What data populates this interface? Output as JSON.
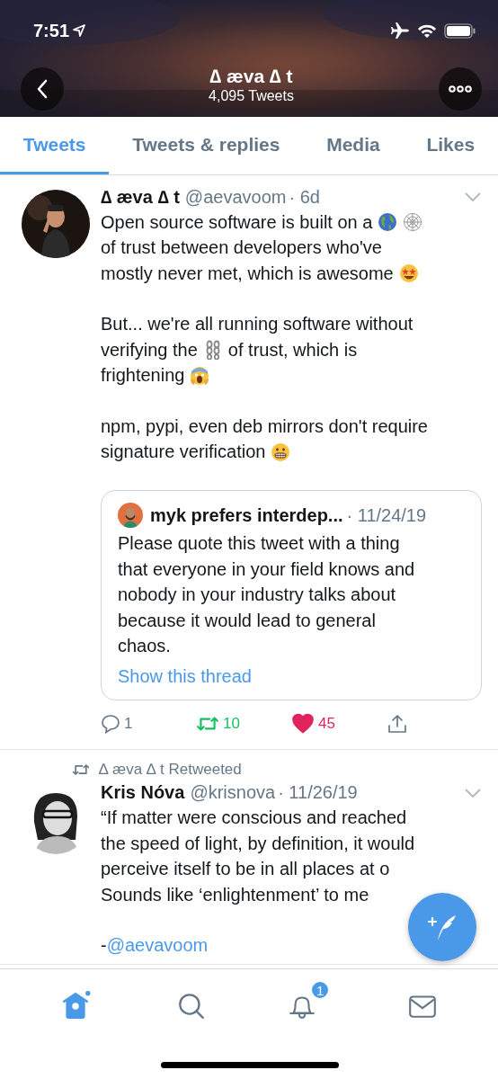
{
  "header": {
    "time": "7:51",
    "name": "∆ æva ∆ t",
    "tweet_count": "4,095 Tweets"
  },
  "tabs": [
    {
      "label": "Tweets",
      "selected": true
    },
    {
      "label": "Tweets & replies",
      "selected": false
    },
    {
      "label": "Media",
      "selected": false
    },
    {
      "label": "Likes",
      "selected": false
    }
  ],
  "tweets": [
    {
      "name": "∆ æva ∆ t",
      "handle": "@aevavoom",
      "time": "· 6d",
      "paragraphs": [
        [
          [
            {
              "text": "Open source software is built on a"
            },
            {
              "kind": "globe"
            },
            {
              "kind": "web"
            }
          ],
          [
            {
              "text": "of trust between developers who've"
            }
          ],
          [
            {
              "text": "mostly never met, which is awesome"
            },
            {
              "kind": "starstruck"
            }
          ]
        ],
        [
          [
            {
              "text": "But... we're all running software without"
            }
          ],
          [
            {
              "text": "verifying the"
            },
            {
              "kind": "chain"
            },
            {
              "text": "of trust, which is"
            }
          ],
          [
            {
              "text": "frightening"
            },
            {
              "kind": "scream"
            }
          ]
        ],
        [
          [
            {
              "text": "npm, pypi, even deb mirrors don't require"
            }
          ],
          [
            {
              "text": "signature verification"
            },
            {
              "kind": "grimace"
            }
          ]
        ]
      ],
      "quote": {
        "name": "myk prefers interdep...",
        "time": "· 11/24/19",
        "lines": [
          "Please quote this tweet with a thing",
          "that everyone in your field knows and",
          "nobody in your industry talks about",
          "because it would lead to general",
          "chaos."
        ],
        "link": "Show this thread"
      },
      "actions": {
        "replies": "1",
        "retweets": "10",
        "likes": "45",
        "retweeted": true,
        "liked": true
      }
    },
    {
      "retweeted_by": "∆ æva ∆ t Retweeted",
      "name": "Kris Nóva",
      "handle": "@krisnova",
      "time": "· 11/26/19",
      "paragraphs": [
        [
          [
            {
              "text": "“If matter were conscious and reached"
            }
          ],
          [
            {
              "text": "the speed of light, by definition, it would"
            }
          ],
          [
            {
              "text": "perceive itself to be in all places at o"
            }
          ],
          [
            {
              "text": "Sounds like ‘enlightenment’ to me"
            }
          ]
        ],
        [
          [
            {
              "text": "-"
            },
            {
              "kind": "link",
              "text": "@aevavoom"
            }
          ]
        ]
      ]
    }
  ],
  "nav": [
    {
      "kind": "home",
      "selected": true
    },
    {
      "kind": "search",
      "selected": false
    },
    {
      "kind": "notifications",
      "selected": false,
      "badge": "1"
    },
    {
      "kind": "messages",
      "selected": false
    }
  ]
}
